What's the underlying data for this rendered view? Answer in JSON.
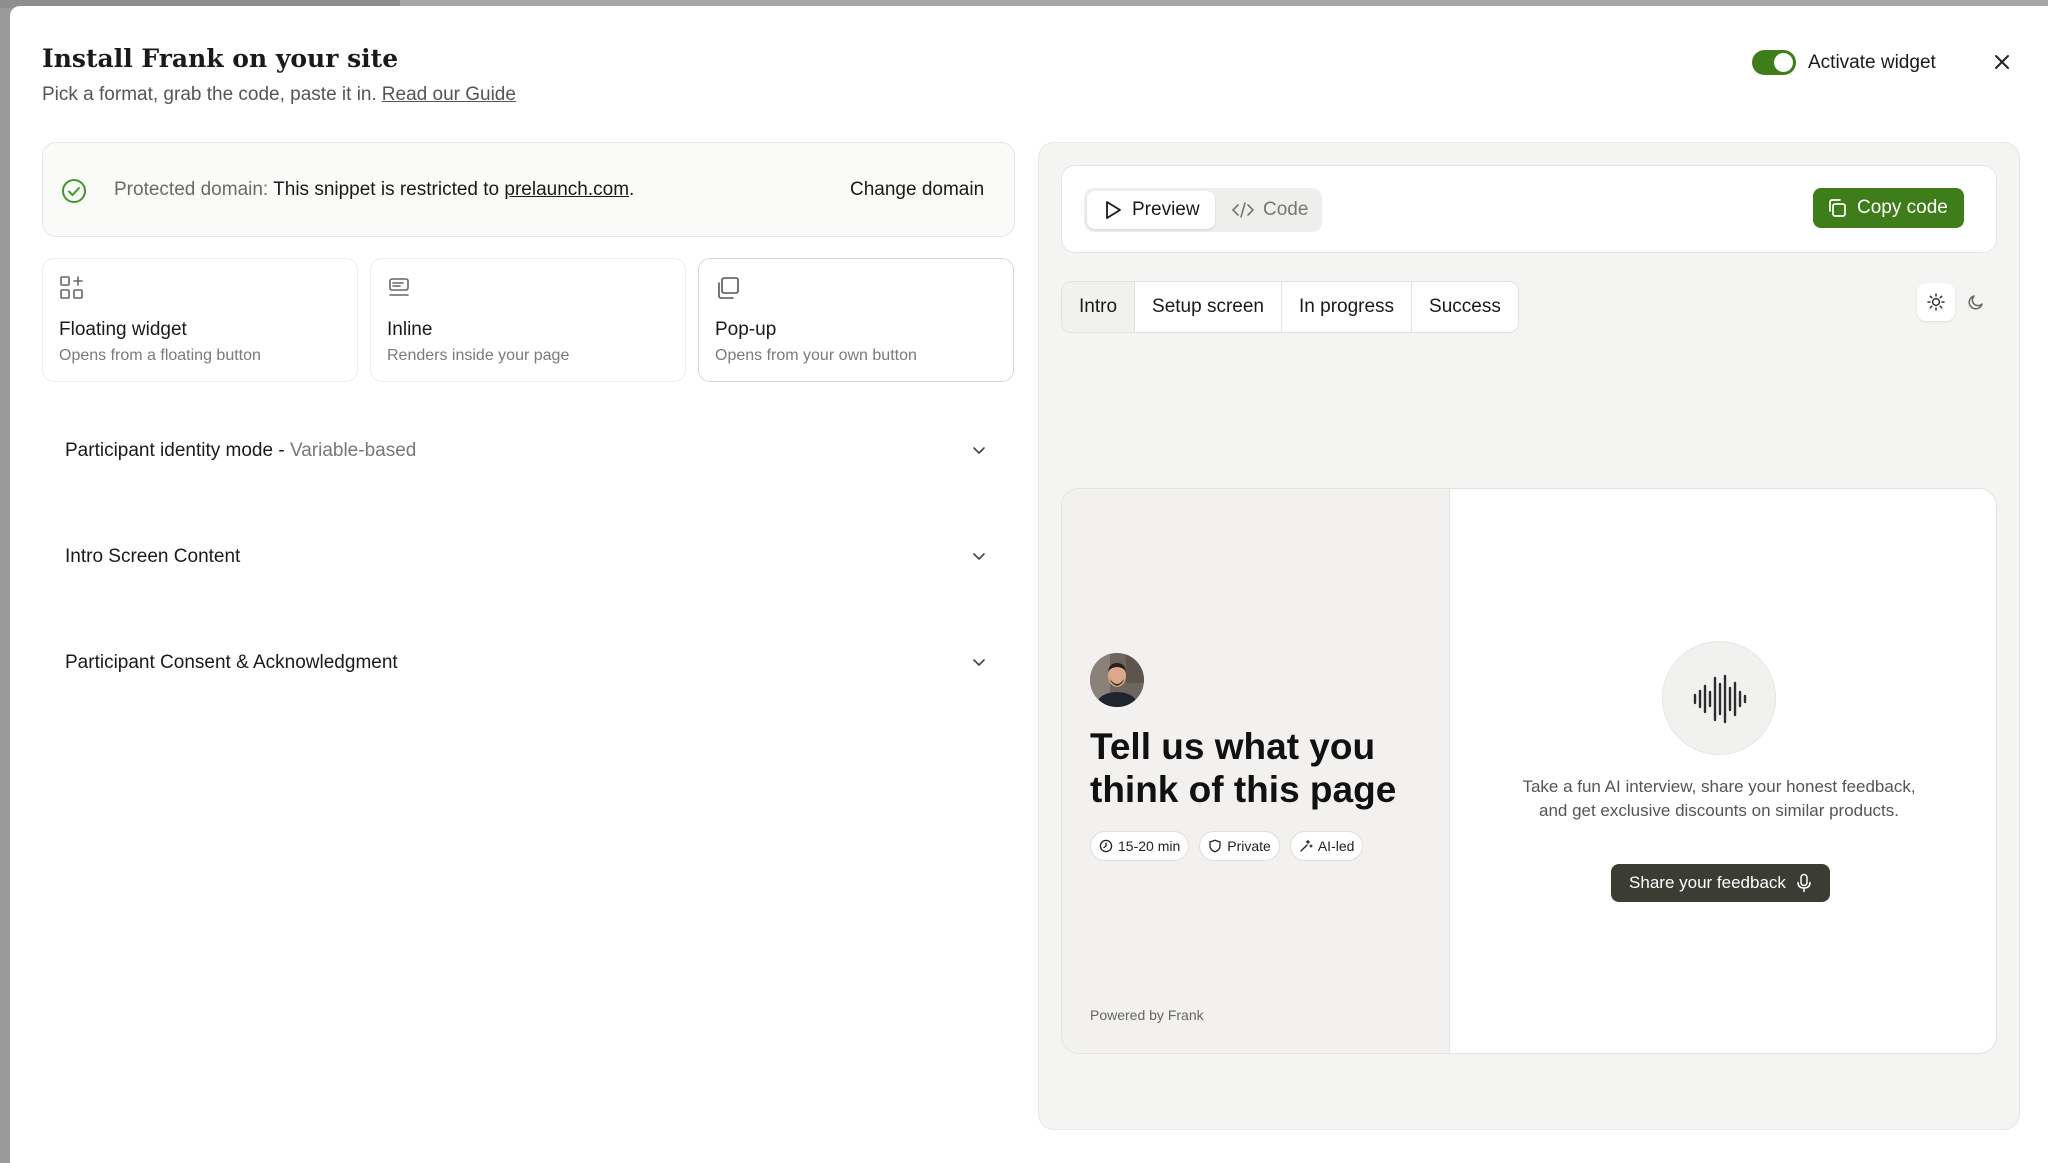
{
  "header": {
    "title": "Install Frank on your site",
    "subtitle": "Pick a format, grab the code, paste it in.",
    "guide_link": "Read our Guide",
    "activate_label": "Activate widget",
    "activate_on": true,
    "close_icon": "close-icon"
  },
  "domain": {
    "prefix": "Protected domain:",
    "text": "This snippet is restricted to",
    "domain": "prelaunch.com",
    "suffix": ".",
    "change_label": "Change domain",
    "check_icon": "check-circle-icon"
  },
  "formats": [
    {
      "icon": "floating-widget-icon",
      "name": "Floating widget",
      "desc": "Opens from a floating button"
    },
    {
      "icon": "inline-icon",
      "name": "Inline",
      "desc": "Renders inside your page"
    },
    {
      "icon": "popup-icon",
      "name": "Pop-up",
      "desc": "Opens from your own button"
    }
  ],
  "selected_format": "Pop-up",
  "accordions": [
    {
      "label": "Participant identity mode -",
      "value": "Variable-based"
    },
    {
      "label": "Intro Screen Content",
      "value": ""
    },
    {
      "label": "Participant Consent & Acknowledgment",
      "value": ""
    }
  ],
  "toolbar": {
    "preview_label": "Preview",
    "code_label": "Code",
    "copy_label": "Copy code",
    "active_view": "Preview"
  },
  "state_tabs": [
    {
      "label": "Intro",
      "active": true
    },
    {
      "label": "Setup screen",
      "active": false
    },
    {
      "label": "In progress",
      "active": false
    },
    {
      "label": "Success",
      "active": false
    }
  ],
  "theme": {
    "light_icon": "sun-icon",
    "dark_icon": "moon-icon",
    "active": "light"
  },
  "widget": {
    "headline": "Tell us what you think of this page",
    "chips": [
      {
        "icon": "clock-icon",
        "label": "15-20 min"
      },
      {
        "icon": "shield-icon",
        "label": "Private"
      },
      {
        "icon": "sparkle-icon",
        "label": "AI-led"
      }
    ],
    "powered": "Powered by Frank",
    "description": "Take a fun AI interview, share your honest feedback, and get exclusive discounts on similar products.",
    "share_label": "Share your feedback",
    "waveform_icon": "waveform-icon",
    "mic_icon": "mic-icon"
  },
  "colors": {
    "accent_green": "#3e7d19",
    "share_button": "#3b3d33",
    "panel_bg": "#f4f4f2"
  }
}
